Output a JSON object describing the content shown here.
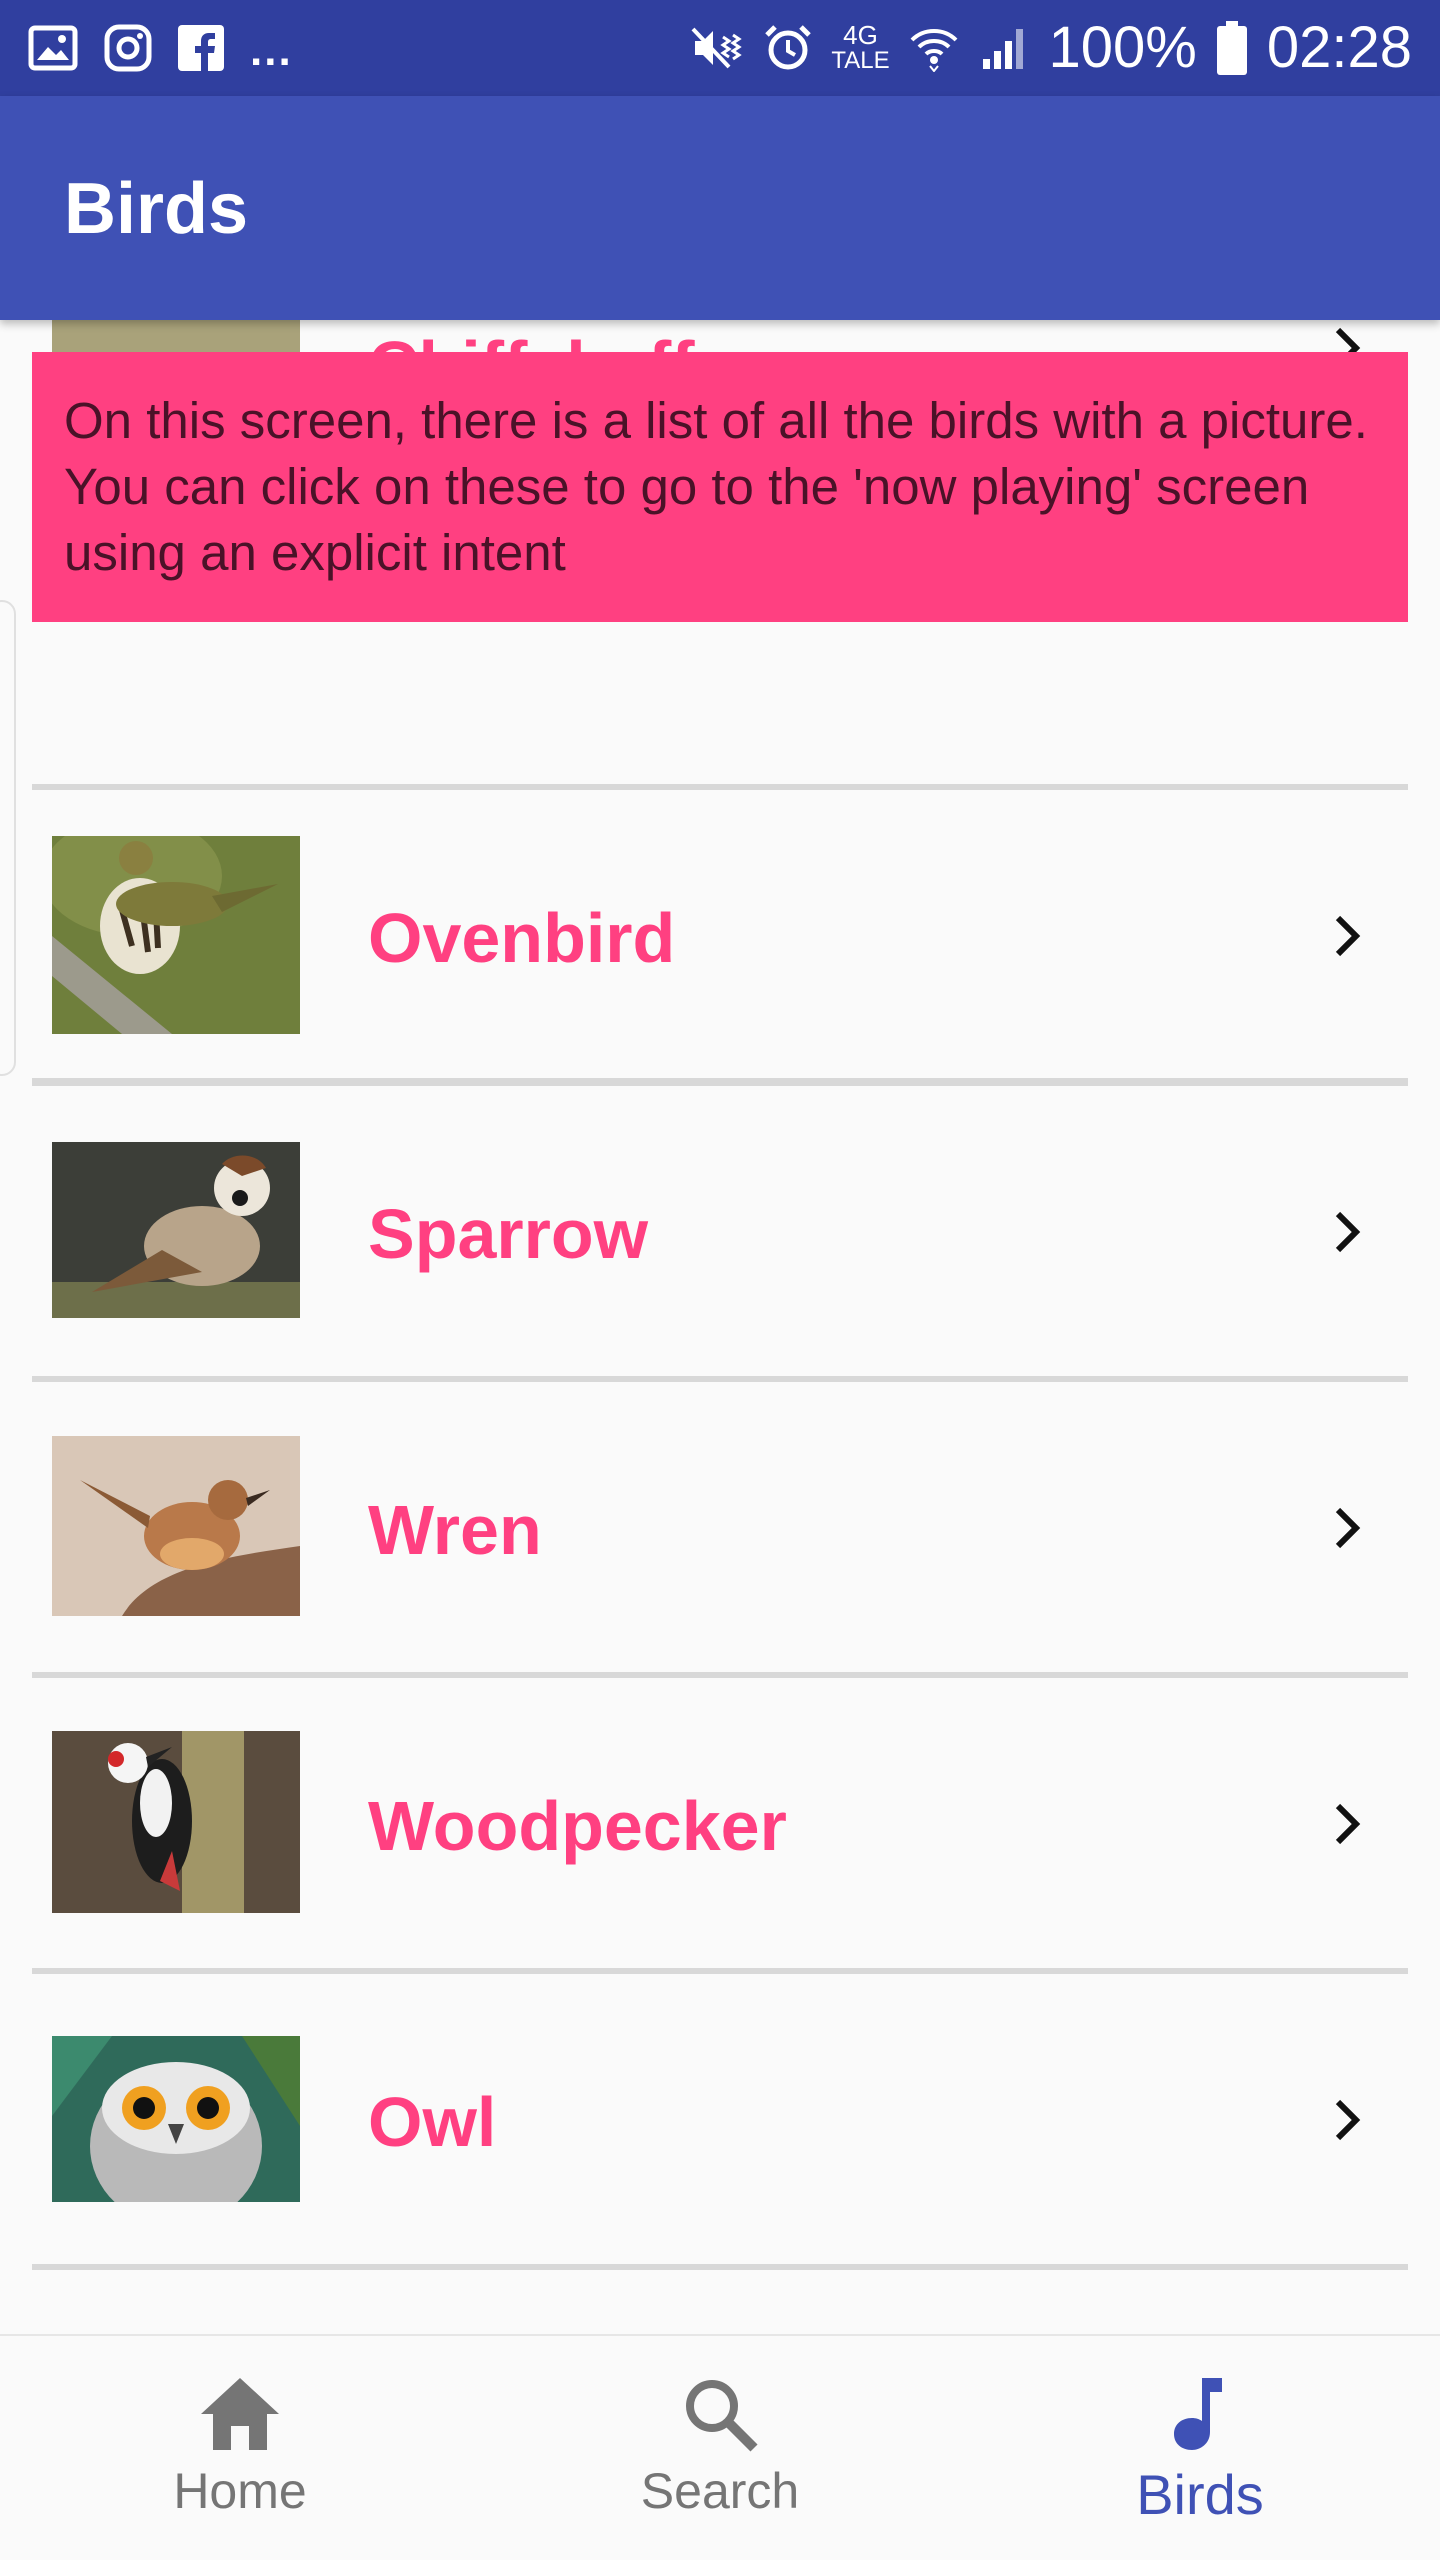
{
  "status_bar": {
    "left_icons": [
      "gallery-icon",
      "instagram-icon",
      "facebook-icon"
    ],
    "more": "...",
    "right_icons": [
      "mute-vibrate-icon",
      "alarm-icon",
      "wifi-icon",
      "signal-icon",
      "battery-icon"
    ],
    "network_top": "4G",
    "network_bottom": "TALE",
    "battery": "100%",
    "time": "02:28"
  },
  "app_bar": {
    "title": "Birds"
  },
  "hint": {
    "text": "On this screen, there is a list of all the birds with a picture. You can click on these to go to the 'now playing' screen using an explicit intent"
  },
  "birds": [
    {
      "name": "Chiffchaff",
      "icon": "chevron-right-icon"
    },
    {
      "name": "Ovenbird",
      "icon": "chevron-right-icon"
    },
    {
      "name": "Sparrow",
      "icon": "chevron-right-icon"
    },
    {
      "name": "Wren",
      "icon": "chevron-right-icon"
    },
    {
      "name": "Woodpecker",
      "icon": "chevron-right-icon"
    },
    {
      "name": "Owl",
      "icon": "chevron-right-icon"
    }
  ],
  "bottom_nav": {
    "items": [
      {
        "label": "Home",
        "icon": "home-icon"
      },
      {
        "label": "Search",
        "icon": "search-icon"
      },
      {
        "label": "Birds",
        "icon": "music-note-icon",
        "active": true
      }
    ]
  },
  "colors": {
    "status_bar": "#303f9f",
    "app_bar": "#3f51b5",
    "accent": "#ff4081",
    "divider": "#d8d8d8",
    "nav_inactive": "#757575"
  }
}
